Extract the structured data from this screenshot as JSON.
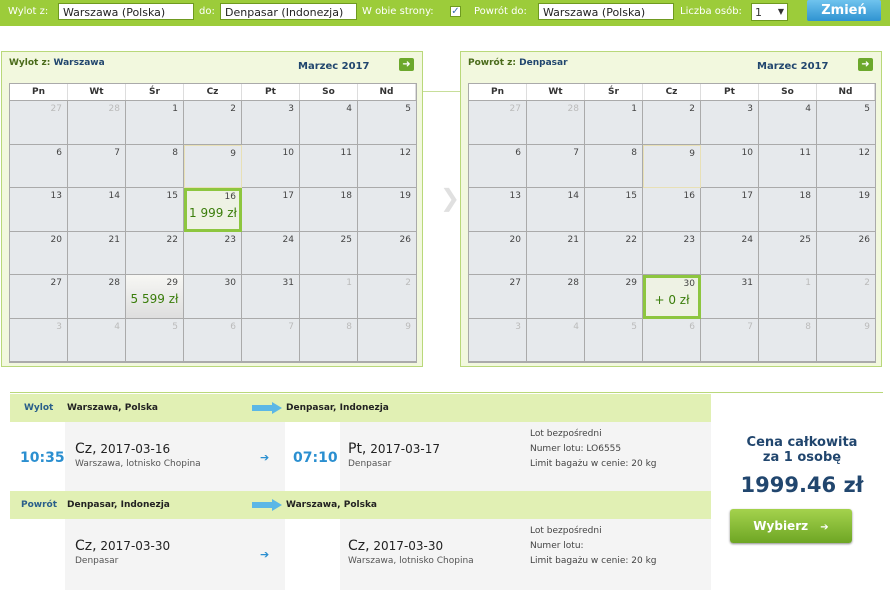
{
  "search": {
    "from_label": "Wylot z:",
    "from_value": "Warszawa (Polska)",
    "to_label": "do:",
    "to_value": "Denpasar (Indonezja)",
    "roundtrip_label": "W obie strony:",
    "roundtrip_checked": true,
    "return_label": "Powrót do:",
    "return_value": "Warszawa (Polska)",
    "pax_label": "Liczba osób:",
    "pax_value": "1",
    "change_button": "Zmień"
  },
  "weekdays": [
    "Pn",
    "Wt",
    "Śr",
    "Cz",
    "Pt",
    "So",
    "Nd"
  ],
  "out_calendar": {
    "title_prefix": "Wylot z:",
    "city": "Warszawa",
    "month": "Marzec 2017",
    "days": [
      {
        "d": "27",
        "out": true
      },
      {
        "d": "28",
        "out": true
      },
      {
        "d": "1"
      },
      {
        "d": "2"
      },
      {
        "d": "3"
      },
      {
        "d": "4"
      },
      {
        "d": "5"
      },
      {
        "d": "6"
      },
      {
        "d": "7"
      },
      {
        "d": "8"
      },
      {
        "d": "9",
        "today": true
      },
      {
        "d": "10"
      },
      {
        "d": "11"
      },
      {
        "d": "12"
      },
      {
        "d": "13"
      },
      {
        "d": "14"
      },
      {
        "d": "15"
      },
      {
        "d": "16",
        "price": "1 999 zł",
        "selected": true
      },
      {
        "d": "17"
      },
      {
        "d": "18"
      },
      {
        "d": "19"
      },
      {
        "d": "20"
      },
      {
        "d": "21"
      },
      {
        "d": "22"
      },
      {
        "d": "23"
      },
      {
        "d": "24"
      },
      {
        "d": "25"
      },
      {
        "d": "26"
      },
      {
        "d": "27"
      },
      {
        "d": "28"
      },
      {
        "d": "29",
        "price": "5 599 zł"
      },
      {
        "d": "30"
      },
      {
        "d": "31"
      },
      {
        "d": "1",
        "out": true
      },
      {
        "d": "2",
        "out": true
      },
      {
        "d": "3",
        "out": true
      },
      {
        "d": "4",
        "out": true
      },
      {
        "d": "5",
        "out": true
      },
      {
        "d": "6",
        "out": true
      },
      {
        "d": "7",
        "out": true
      },
      {
        "d": "8",
        "out": true
      },
      {
        "d": "9",
        "out": true
      }
    ]
  },
  "ret_calendar": {
    "title_prefix": "Powrót z:",
    "city": "Denpasar",
    "month": "Marzec 2017",
    "days": [
      {
        "d": "27",
        "out": true
      },
      {
        "d": "28",
        "out": true
      },
      {
        "d": "1"
      },
      {
        "d": "2"
      },
      {
        "d": "3"
      },
      {
        "d": "4"
      },
      {
        "d": "5"
      },
      {
        "d": "6"
      },
      {
        "d": "7"
      },
      {
        "d": "8"
      },
      {
        "d": "9",
        "today": true
      },
      {
        "d": "10"
      },
      {
        "d": "11"
      },
      {
        "d": "12"
      },
      {
        "d": "13"
      },
      {
        "d": "14"
      },
      {
        "d": "15"
      },
      {
        "d": "16"
      },
      {
        "d": "17"
      },
      {
        "d": "18"
      },
      {
        "d": "19"
      },
      {
        "d": "20"
      },
      {
        "d": "21"
      },
      {
        "d": "22"
      },
      {
        "d": "23"
      },
      {
        "d": "24"
      },
      {
        "d": "25"
      },
      {
        "d": "26"
      },
      {
        "d": "27"
      },
      {
        "d": "28"
      },
      {
        "d": "29"
      },
      {
        "d": "30",
        "price": "+ 0 zł",
        "selected": true
      },
      {
        "d": "31"
      },
      {
        "d": "1",
        "out": true
      },
      {
        "d": "2",
        "out": true
      },
      {
        "d": "3",
        "out": true
      },
      {
        "d": "4",
        "out": true
      },
      {
        "d": "5",
        "out": true
      },
      {
        "d": "6",
        "out": true
      },
      {
        "d": "7",
        "out": true
      },
      {
        "d": "8",
        "out": true
      },
      {
        "d": "9",
        "out": true
      }
    ]
  },
  "outbound": {
    "label": "Wylot",
    "from": "Warszawa, Polska",
    "to": "Denpasar, Indonezja",
    "dep_time": "10:35",
    "dep_day": "Cz,",
    "dep_date": "2017-03-16",
    "dep_place": "Warszawa, lotnisko Chopina",
    "arr_time": "07:10",
    "arr_day": "Pt,",
    "arr_date": "2017-03-17",
    "arr_place": "Denpasar",
    "info1": "Lot bezpośredni",
    "info2": "Numer lotu: LO6555",
    "info3": "Limit bagażu w cenie: 20 kg"
  },
  "inbound": {
    "label": "Powrót",
    "from": "Denpasar, Indonezja",
    "to": "Warszawa, Polska",
    "dep_time": "",
    "dep_day": "Cz,",
    "dep_date": "2017-03-30",
    "dep_place": "Denpasar",
    "arr_time": "",
    "arr_day": "Cz,",
    "arr_date": "2017-03-30",
    "arr_place": "Warszawa, lotnisko Chopina",
    "info1": "Lot bezpośredni",
    "info2": "Numer lotu:",
    "info3": "Limit bagażu w cenie: 20 kg"
  },
  "price": {
    "caption_line1": "Cena całkowita",
    "caption_line2": "za 1 osobę",
    "amount": "1999.46 zł",
    "select_button": "Wybierz"
  },
  "colors": {
    "brand_green": "#9ccc3a",
    "accent_blue": "#2b8fd0",
    "dark_blue": "#21466e",
    "price_green": "#3a7d0a"
  }
}
